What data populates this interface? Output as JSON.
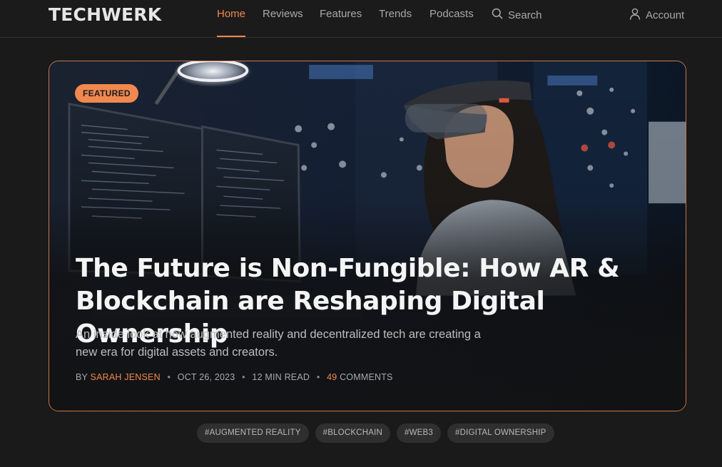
{
  "header": {
    "logo": "TECHWERK",
    "nav": [
      {
        "label": "Home",
        "active": true
      },
      {
        "label": "Reviews"
      },
      {
        "label": "Features"
      },
      {
        "label": "Trends"
      },
      {
        "label": "Podcasts"
      }
    ],
    "search_label": "Search",
    "account_label": "Account"
  },
  "hero": {
    "badge": "FEATURED",
    "title": "The Future is Non-Fungible: How AR & Blockchain are Reshaping Digital Ownership",
    "subtitle": "An inside look at how augmented reality and decentralized tech are creating a new era for digital assets and creators.",
    "meta": {
      "by": "BY",
      "author": "SARAH JENSEN",
      "date": "OCT 26, 2023",
      "read_time": "12 MIN READ",
      "comments_count": "49",
      "comments_label": "COMMENTS"
    }
  },
  "tags": [
    "#AUGMENTED REALITY",
    "#BLOCKCHAIN",
    "#WEB3",
    "#DIGITAL OWNERSHIP"
  ],
  "colors": {
    "accent": "#f0884f",
    "background": "#1a1a1a",
    "tag_bg": "#2f2f2f"
  }
}
